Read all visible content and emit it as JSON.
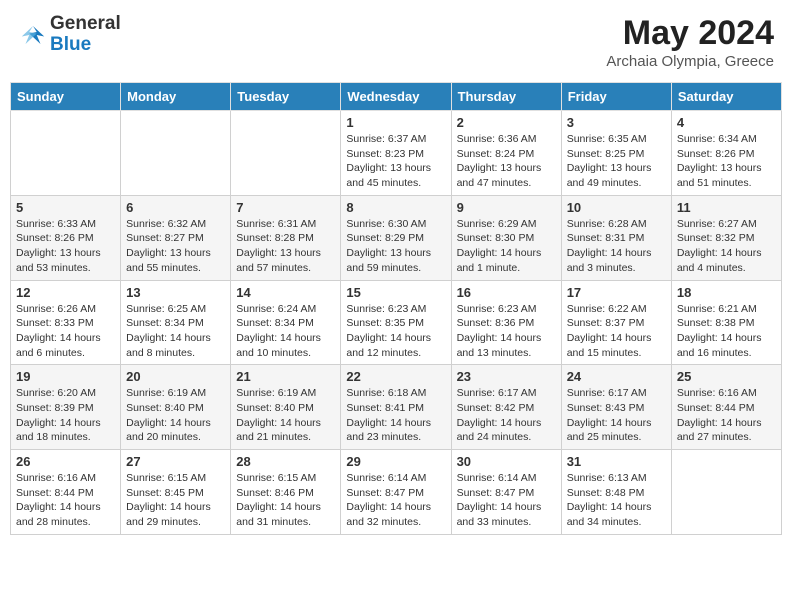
{
  "header": {
    "logo_general": "General",
    "logo_blue": "Blue",
    "month_year": "May 2024",
    "location": "Archaia Olympia, Greece"
  },
  "days_of_week": [
    "Sunday",
    "Monday",
    "Tuesday",
    "Wednesday",
    "Thursday",
    "Friday",
    "Saturday"
  ],
  "weeks": [
    [
      {
        "day": "",
        "info": ""
      },
      {
        "day": "",
        "info": ""
      },
      {
        "day": "",
        "info": ""
      },
      {
        "day": "1",
        "info": "Sunrise: 6:37 AM\nSunset: 8:23 PM\nDaylight: 13 hours\nand 45 minutes."
      },
      {
        "day": "2",
        "info": "Sunrise: 6:36 AM\nSunset: 8:24 PM\nDaylight: 13 hours\nand 47 minutes."
      },
      {
        "day": "3",
        "info": "Sunrise: 6:35 AM\nSunset: 8:25 PM\nDaylight: 13 hours\nand 49 minutes."
      },
      {
        "day": "4",
        "info": "Sunrise: 6:34 AM\nSunset: 8:26 PM\nDaylight: 13 hours\nand 51 minutes."
      }
    ],
    [
      {
        "day": "5",
        "info": "Sunrise: 6:33 AM\nSunset: 8:26 PM\nDaylight: 13 hours\nand 53 minutes."
      },
      {
        "day": "6",
        "info": "Sunrise: 6:32 AM\nSunset: 8:27 PM\nDaylight: 13 hours\nand 55 minutes."
      },
      {
        "day": "7",
        "info": "Sunrise: 6:31 AM\nSunset: 8:28 PM\nDaylight: 13 hours\nand 57 minutes."
      },
      {
        "day": "8",
        "info": "Sunrise: 6:30 AM\nSunset: 8:29 PM\nDaylight: 13 hours\nand 59 minutes."
      },
      {
        "day": "9",
        "info": "Sunrise: 6:29 AM\nSunset: 8:30 PM\nDaylight: 14 hours\nand 1 minute."
      },
      {
        "day": "10",
        "info": "Sunrise: 6:28 AM\nSunset: 8:31 PM\nDaylight: 14 hours\nand 3 minutes."
      },
      {
        "day": "11",
        "info": "Sunrise: 6:27 AM\nSunset: 8:32 PM\nDaylight: 14 hours\nand 4 minutes."
      }
    ],
    [
      {
        "day": "12",
        "info": "Sunrise: 6:26 AM\nSunset: 8:33 PM\nDaylight: 14 hours\nand 6 minutes."
      },
      {
        "day": "13",
        "info": "Sunrise: 6:25 AM\nSunset: 8:34 PM\nDaylight: 14 hours\nand 8 minutes."
      },
      {
        "day": "14",
        "info": "Sunrise: 6:24 AM\nSunset: 8:34 PM\nDaylight: 14 hours\nand 10 minutes."
      },
      {
        "day": "15",
        "info": "Sunrise: 6:23 AM\nSunset: 8:35 PM\nDaylight: 14 hours\nand 12 minutes."
      },
      {
        "day": "16",
        "info": "Sunrise: 6:23 AM\nSunset: 8:36 PM\nDaylight: 14 hours\nand 13 minutes."
      },
      {
        "day": "17",
        "info": "Sunrise: 6:22 AM\nSunset: 8:37 PM\nDaylight: 14 hours\nand 15 minutes."
      },
      {
        "day": "18",
        "info": "Sunrise: 6:21 AM\nSunset: 8:38 PM\nDaylight: 14 hours\nand 16 minutes."
      }
    ],
    [
      {
        "day": "19",
        "info": "Sunrise: 6:20 AM\nSunset: 8:39 PM\nDaylight: 14 hours\nand 18 minutes."
      },
      {
        "day": "20",
        "info": "Sunrise: 6:19 AM\nSunset: 8:40 PM\nDaylight: 14 hours\nand 20 minutes."
      },
      {
        "day": "21",
        "info": "Sunrise: 6:19 AM\nSunset: 8:40 PM\nDaylight: 14 hours\nand 21 minutes."
      },
      {
        "day": "22",
        "info": "Sunrise: 6:18 AM\nSunset: 8:41 PM\nDaylight: 14 hours\nand 23 minutes."
      },
      {
        "day": "23",
        "info": "Sunrise: 6:17 AM\nSunset: 8:42 PM\nDaylight: 14 hours\nand 24 minutes."
      },
      {
        "day": "24",
        "info": "Sunrise: 6:17 AM\nSunset: 8:43 PM\nDaylight: 14 hours\nand 25 minutes."
      },
      {
        "day": "25",
        "info": "Sunrise: 6:16 AM\nSunset: 8:44 PM\nDaylight: 14 hours\nand 27 minutes."
      }
    ],
    [
      {
        "day": "26",
        "info": "Sunrise: 6:16 AM\nSunset: 8:44 PM\nDaylight: 14 hours\nand 28 minutes."
      },
      {
        "day": "27",
        "info": "Sunrise: 6:15 AM\nSunset: 8:45 PM\nDaylight: 14 hours\nand 29 minutes."
      },
      {
        "day": "28",
        "info": "Sunrise: 6:15 AM\nSunset: 8:46 PM\nDaylight: 14 hours\nand 31 minutes."
      },
      {
        "day": "29",
        "info": "Sunrise: 6:14 AM\nSunset: 8:47 PM\nDaylight: 14 hours\nand 32 minutes."
      },
      {
        "day": "30",
        "info": "Sunrise: 6:14 AM\nSunset: 8:47 PM\nDaylight: 14 hours\nand 33 minutes."
      },
      {
        "day": "31",
        "info": "Sunrise: 6:13 AM\nSunset: 8:48 PM\nDaylight: 14 hours\nand 34 minutes."
      },
      {
        "day": "",
        "info": ""
      }
    ]
  ]
}
